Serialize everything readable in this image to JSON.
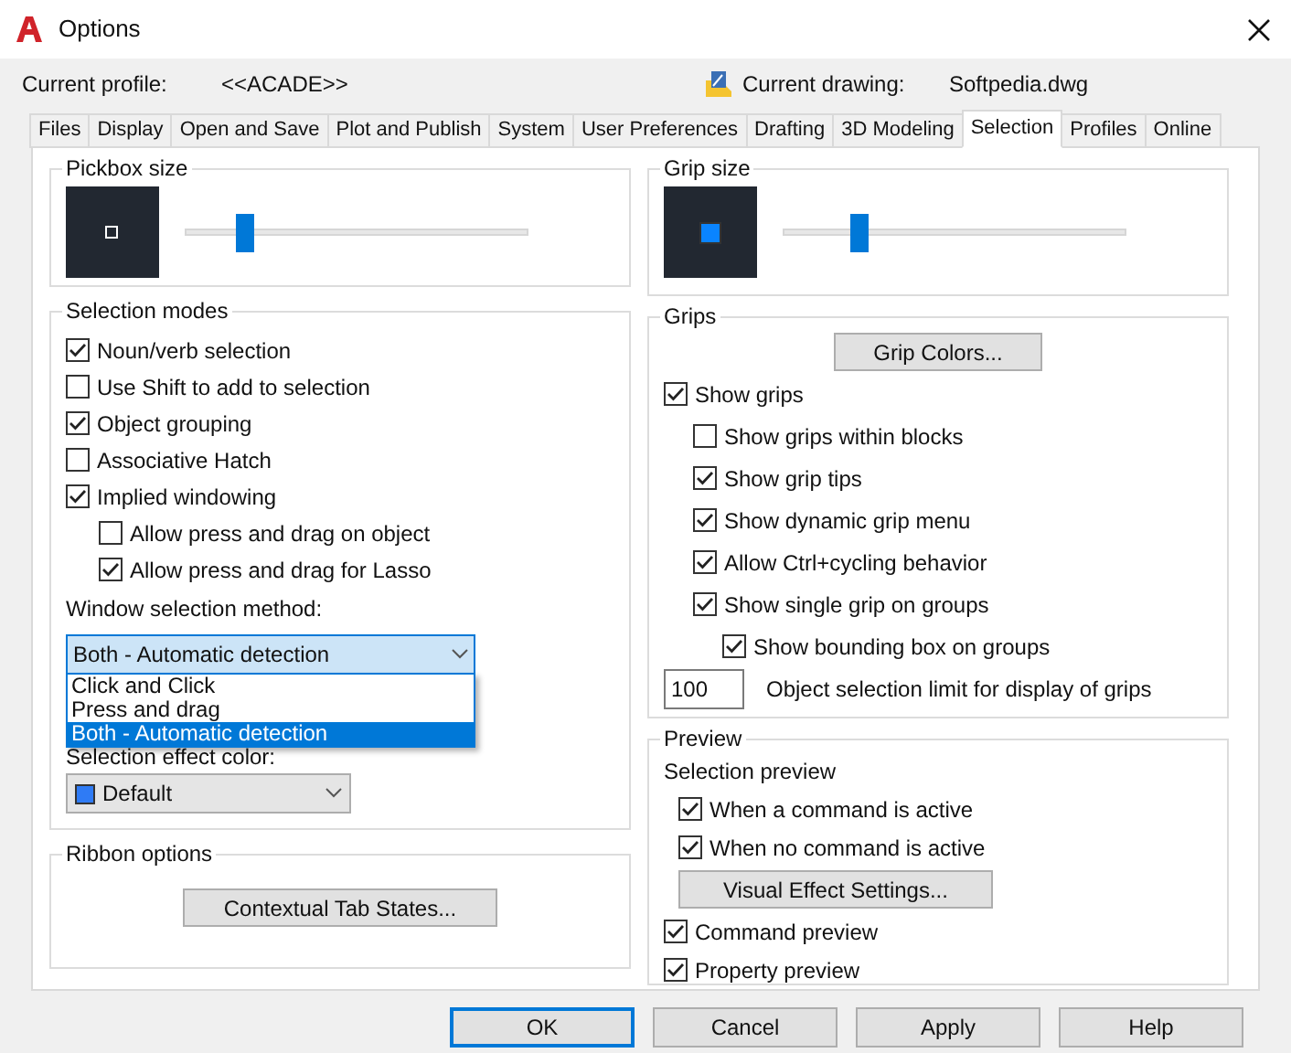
{
  "window": {
    "title": "Options"
  },
  "profile": {
    "label": "Current profile:",
    "value": "<<ACADE>>"
  },
  "drawing": {
    "label": "Current drawing:",
    "value": "Softpedia.dwg"
  },
  "tabs": [
    {
      "label": "Files",
      "selected": false
    },
    {
      "label": "Display",
      "selected": false
    },
    {
      "label": "Open and Save",
      "selected": false
    },
    {
      "label": "Plot and Publish",
      "selected": false
    },
    {
      "label": "System",
      "selected": false
    },
    {
      "label": "User Preferences",
      "selected": false
    },
    {
      "label": "Drafting",
      "selected": false
    },
    {
      "label": "3D Modeling",
      "selected": false
    },
    {
      "label": "Selection",
      "selected": true
    },
    {
      "label": "Profiles",
      "selected": false
    },
    {
      "label": "Online",
      "selected": false
    }
  ],
  "pickbox": {
    "title": "Pickbox size",
    "level": 0.17
  },
  "selection_modes": {
    "title": "Selection modes",
    "options": [
      {
        "label": "Noun/verb selection",
        "checked": true
      },
      {
        "label": "Use Shift to add to selection",
        "checked": false
      },
      {
        "label": "Object grouping",
        "checked": true
      },
      {
        "label": "Associative Hatch",
        "checked": false
      },
      {
        "label": "Implied windowing",
        "checked": true,
        "children": [
          {
            "label": "Allow press and drag on object",
            "checked": false
          },
          {
            "label": "Allow press and drag for Lasso",
            "checked": true
          }
        ]
      }
    ],
    "window_method": {
      "label": "Window selection method:",
      "value": "Both - Automatic detection",
      "options": [
        {
          "label": "Click and Click",
          "selected": false
        },
        {
          "label": "Press and drag",
          "selected": false
        },
        {
          "label": "Both - Automatic detection",
          "selected": true
        }
      ]
    },
    "effect_color": {
      "label": "Selection effect color:",
      "value": "Default",
      "color": "#2f7bf5"
    }
  },
  "ribbon": {
    "title": "Ribbon options",
    "button": "Contextual Tab States..."
  },
  "grip_size": {
    "title": "Grip size",
    "level": 0.22
  },
  "grips": {
    "title": "Grips",
    "button": "Grip Colors...",
    "options": [
      {
        "label": "Show grips",
        "checked": true,
        "children": [
          {
            "label": "Show grips within blocks",
            "checked": false
          },
          {
            "label": "Show grip tips",
            "checked": true
          },
          {
            "label": "Show dynamic grip menu",
            "checked": true
          },
          {
            "label": "Allow Ctrl+cycling behavior",
            "checked": true
          },
          {
            "label": "Show single grip on groups",
            "checked": true,
            "children": [
              {
                "label": "Show bounding box on groups",
                "checked": true
              }
            ]
          }
        ]
      }
    ],
    "limit": {
      "value": "100",
      "label": "Object selection limit for display of grips"
    }
  },
  "preview": {
    "title": "Preview",
    "options": [
      {
        "kind": "label",
        "label": "Selection preview",
        "children": [
          {
            "kind": "checkbox",
            "label": "When a command is active",
            "checked": true
          },
          {
            "kind": "checkbox",
            "label": "When no command is active",
            "checked": true
          },
          {
            "kind": "button",
            "label": "Visual Effect Settings..."
          }
        ]
      },
      {
        "kind": "checkbox",
        "label": "Command preview",
        "checked": true
      },
      {
        "kind": "checkbox",
        "label": "Property preview",
        "checked": true
      }
    ]
  },
  "buttons": [
    {
      "label": "OK",
      "selected": true
    },
    {
      "label": "Cancel",
      "selected": false
    },
    {
      "label": "Apply",
      "selected": false
    },
    {
      "label": "Help",
      "selected": false
    }
  ]
}
